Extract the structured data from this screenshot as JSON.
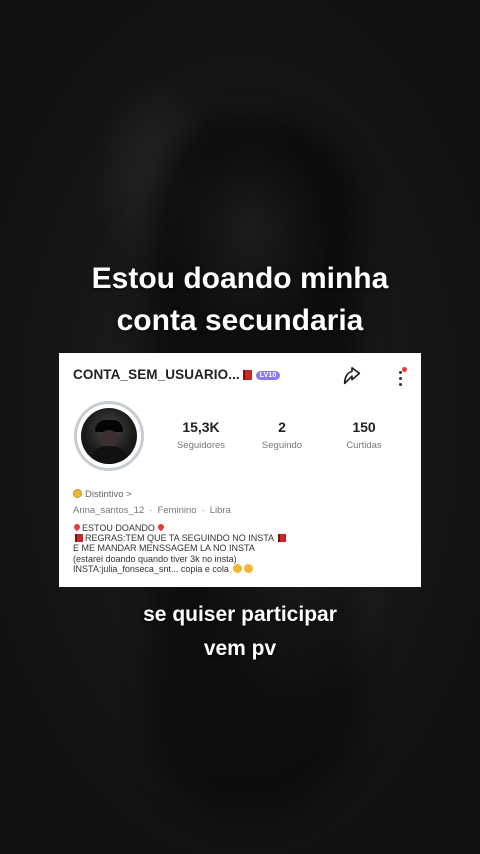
{
  "caption_top": [
    "Estou doando minha",
    "conta secundaria"
  ],
  "caption_bottom": [
    "se quiser participar",
    "vem pv"
  ],
  "profile": {
    "username": "CONTA_SEM_USUARIO...",
    "level_badge": "LV10",
    "stats": [
      {
        "value": "15,3K",
        "label": "Seguidores"
      },
      {
        "value": "2",
        "label": "Seguindo"
      },
      {
        "value": "150",
        "label": "Curtidas"
      }
    ],
    "badge_label": "Distintivo >",
    "handle": "Anna_santos_12",
    "gender": "Feminino",
    "sign": "Libra",
    "separator": "·",
    "bio": {
      "line1": "ESTOU DOANDO",
      "line2": "REGRAS:TEM QUE TA SEGUINDO NO INSTA",
      "line3": "E ME MANDAR MENSSAGEM LA NO INSTA",
      "line4": "(estarei doando quando tiver 3k no insta)",
      "line5": "INSTA:julia_fonseca_snt... copia e cola"
    }
  },
  "icons": {
    "share": "share-icon",
    "more": "more-vertical-icon",
    "coin": "coin-icon"
  },
  "colors": {
    "card_bg": "#ffffff",
    "badge": "#8a7cf0",
    "accent_red": "#e53935"
  }
}
